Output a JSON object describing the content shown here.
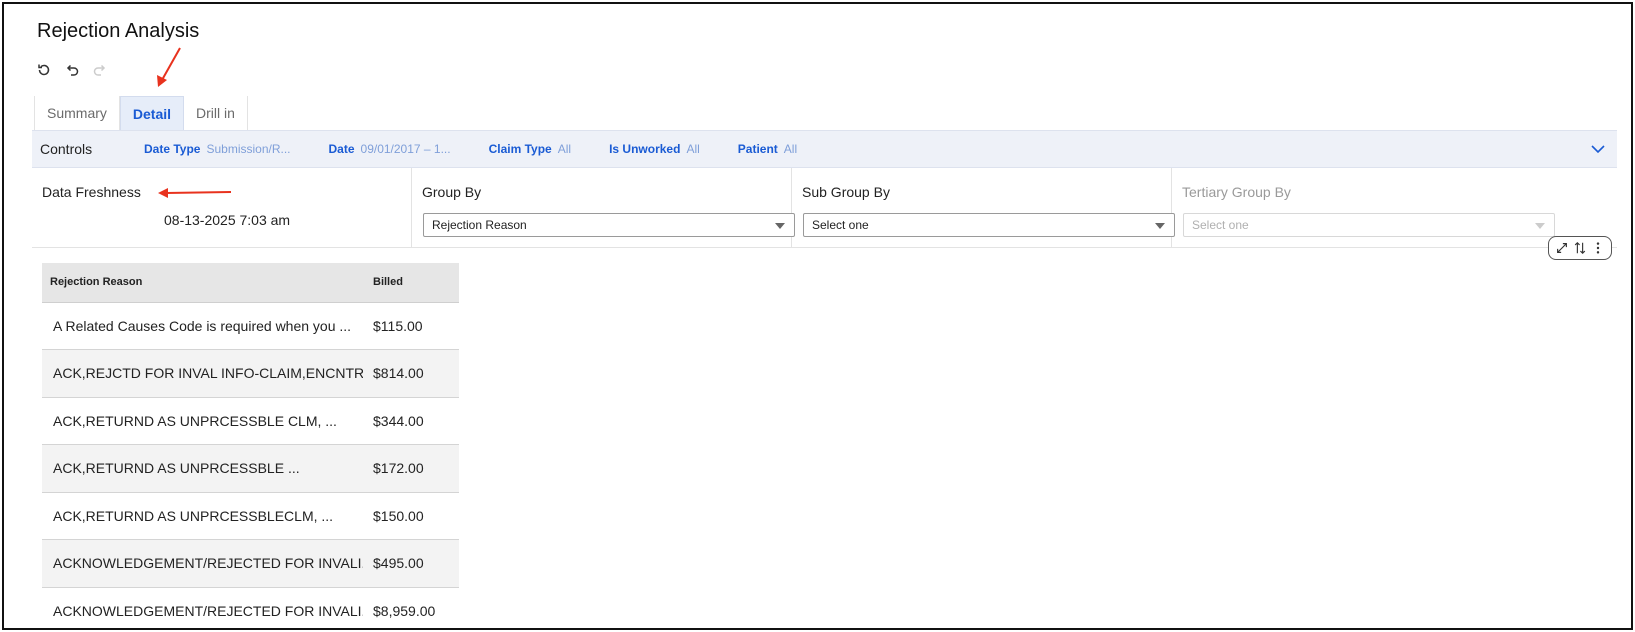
{
  "page": {
    "title": "Rejection Analysis"
  },
  "toolbar": {
    "icons": [
      "refresh-icon",
      "undo-icon",
      "redo-icon"
    ]
  },
  "tabs": [
    {
      "label": "Summary",
      "active": false
    },
    {
      "label": "Detail",
      "active": true
    },
    {
      "label": "Drill in",
      "active": false
    }
  ],
  "controls": {
    "title": "Controls",
    "filters": [
      {
        "label": "Date Type",
        "value": "Submission/R..."
      },
      {
        "label": "Date",
        "value": "09/01/2017 – 1..."
      },
      {
        "label": "Claim Type",
        "value": "All"
      },
      {
        "label": "Is Unworked",
        "value": "All"
      },
      {
        "label": "Patient",
        "value": "All"
      }
    ]
  },
  "freshness": {
    "label": "Data Freshness",
    "time": "08-13-2025 7:03 am"
  },
  "grouping": {
    "group_by": {
      "label": "Group By",
      "value": "Rejection Reason"
    },
    "sub_group_by": {
      "label": "Sub Group By",
      "value": "Select one"
    },
    "tertiary_group_by": {
      "label": "Tertiary Group By",
      "value": "Select one"
    }
  },
  "table": {
    "columns": [
      "Rejection Reason",
      "Billed"
    ],
    "rows": [
      {
        "reason": "A Related Causes Code is required when you ...",
        "billed": "$115.00"
      },
      {
        "reason": "ACK,REJCTD FOR INVAL INFO-CLAIM,ENCNTR...",
        "billed": "$814.00"
      },
      {
        "reason": "ACK,RETURND AS UNPRCESSBLE CLM, ...",
        "billed": "$344.00"
      },
      {
        "reason": "ACK,RETURND AS UNPRCESSBLE ...",
        "billed": "$172.00"
      },
      {
        "reason": "ACK,RETURND AS UNPRCESSBLECLM, ...",
        "billed": "$150.00"
      },
      {
        "reason": "ACKNOWLEDGEMENT/REJECTED FOR INVALI...",
        "billed": "$495.00"
      },
      {
        "reason": "ACKNOWLEDGEMENT/REJECTED FOR INVALI...",
        "billed": "$8,959.00"
      }
    ]
  },
  "colors": {
    "accent": "#1a5bd4",
    "annotation_arrow": "#e8321e",
    "controls_bg": "#eef1f8"
  }
}
